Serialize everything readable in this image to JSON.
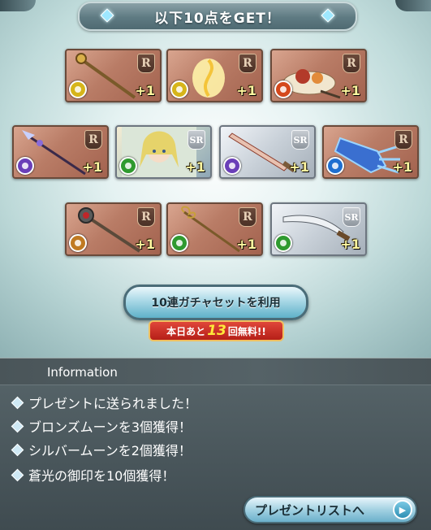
{
  "title_banner": {
    "label": "以下10点をGET！"
  },
  "items": [
    {
      "rarity": "R",
      "element": "light",
      "element_color": "#d6b51a",
      "art": "staff-icon",
      "count": "+1"
    },
    {
      "rarity": "R",
      "element": "light",
      "element_color": "#d6b51a",
      "art": "light-orb-icon",
      "count": "+1"
    },
    {
      "rarity": "R",
      "element": "fire",
      "element_color": "#d4481c",
      "art": "food-plate-icon",
      "count": "+1"
    },
    {
      "rarity": "R",
      "element": "dark",
      "element_color": "#6a3fb8",
      "art": "spear-icon",
      "count": "+1"
    },
    {
      "rarity": "SR",
      "element": "wind",
      "element_color": "#2f9a2f",
      "art": "character-portrait-icon",
      "count": "+1"
    },
    {
      "rarity": "SR",
      "element": "dark",
      "element_color": "#6a3fb8",
      "art": "sword-icon",
      "count": "+1"
    },
    {
      "rarity": "R",
      "element": "water",
      "element_color": "#1e6fd0",
      "art": "gauntlet-icon",
      "count": "+1"
    },
    {
      "rarity": "R",
      "element": "earth",
      "element_color": "#c07a22",
      "art": "mace-icon",
      "count": "+1"
    },
    {
      "rarity": "R",
      "element": "wind",
      "element_color": "#2f9a2f",
      "art": "wand-icon",
      "count": "+1"
    },
    {
      "rarity": "SR",
      "element": "wind",
      "element_color": "#2f9a2f",
      "art": "katana-icon",
      "count": "+1"
    }
  ],
  "gacha_button": {
    "label": "10連ガチャセットを利用"
  },
  "free_badge": {
    "prefix": "本日あと",
    "count": "13",
    "suffix": "回無料!!"
  },
  "info": {
    "header": "Information",
    "lines": [
      "プレゼントに送られました！",
      "ブロンズムーンを3個獲得！",
      "シルバームーンを2個獲得！",
      "蒼光の御印を10個獲得！"
    ]
  },
  "present_button": {
    "label": "プレゼントリストへ"
  }
}
